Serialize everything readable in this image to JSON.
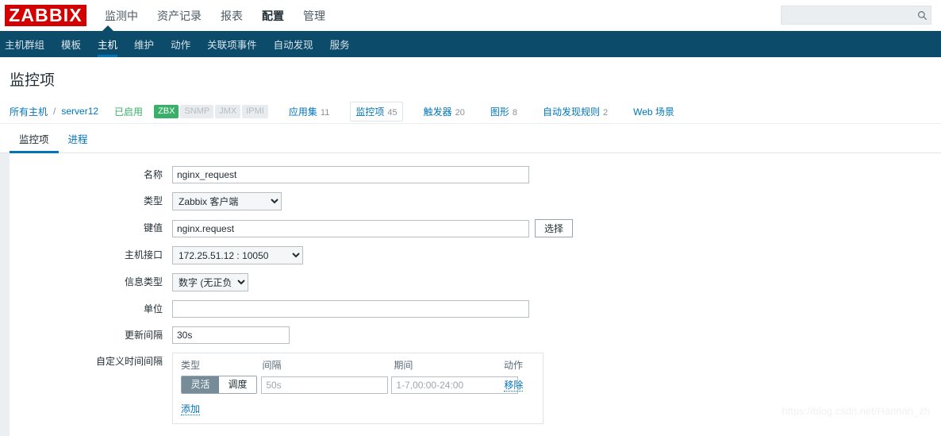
{
  "header": {
    "logo_text": "ZABBIX",
    "brand_color": "#d40000",
    "main_nav": [
      {
        "label": "监测中",
        "active": false
      },
      {
        "label": "资产记录",
        "active": false
      },
      {
        "label": "报表",
        "active": false
      },
      {
        "label": "配置",
        "active": true
      },
      {
        "label": "管理",
        "active": false
      }
    ],
    "search": {
      "value": "",
      "placeholder": "",
      "icon": "search-icon"
    }
  },
  "subnav": {
    "background": "#0c4b69",
    "items": [
      {
        "label": "主机群组",
        "active": false
      },
      {
        "label": "模板",
        "active": false
      },
      {
        "label": "主机",
        "active": true
      },
      {
        "label": "维护",
        "active": false
      },
      {
        "label": "动作",
        "active": false
      },
      {
        "label": "关联项事件",
        "active": false
      },
      {
        "label": "自动发现",
        "active": false
      },
      {
        "label": "服务",
        "active": false
      }
    ]
  },
  "page": {
    "title": "监控项"
  },
  "object_nav": {
    "breadcrumb_root": "所有主机",
    "separator": "/",
    "host": "server12",
    "status": "已启用",
    "status_color": "#3aaf6a",
    "protocols": [
      {
        "label": "ZBX",
        "enabled": true
      },
      {
        "label": "SNMP",
        "enabled": false
      },
      {
        "label": "JMX",
        "enabled": false
      },
      {
        "label": "IPMI",
        "enabled": false
      }
    ],
    "links": [
      {
        "label": "应用集",
        "count": "11",
        "selected": false
      },
      {
        "label": "监控项",
        "count": "45",
        "selected": true
      },
      {
        "label": "触发器",
        "count": "20",
        "selected": false
      },
      {
        "label": "图形",
        "count": "8",
        "selected": false
      },
      {
        "label": "自动发现规则",
        "count": "2",
        "selected": false
      },
      {
        "label": "Web 场景",
        "count": "",
        "selected": false
      }
    ]
  },
  "form_tabs": [
    {
      "label": "监控项",
      "active": true
    },
    {
      "label": "进程",
      "active": false
    }
  ],
  "form": {
    "name": {
      "label": "名称",
      "value": "nginx_request",
      "placeholder": ""
    },
    "type": {
      "label": "类型",
      "value": "Zabbix 客户端",
      "options": [
        "Zabbix 客户端"
      ]
    },
    "key": {
      "label": "键值",
      "value": "nginx.request",
      "placeholder": "",
      "button": "选择"
    },
    "host_interface": {
      "label": "主机接口",
      "value": "172.25.51.12 : 10050",
      "options": [
        "172.25.51.12 : 10050"
      ]
    },
    "info_type": {
      "label": "信息类型",
      "value": "数字 (无正负)",
      "options": [
        "数字 (无正负)"
      ]
    },
    "units": {
      "label": "单位",
      "value": "",
      "placeholder": ""
    },
    "update_interval": {
      "label": "更新间隔",
      "value": "30s",
      "placeholder": ""
    },
    "custom_intervals": {
      "label": "自定义时间间隔",
      "columns": [
        "类型",
        "间隔",
        "期间",
        "动作"
      ],
      "rows": [
        {
          "type_options": [
            {
              "label": "灵活",
              "active": true
            },
            {
              "label": "调度",
              "active": false
            }
          ],
          "interval_value": "",
          "interval_placeholder": "50s",
          "period_value": "",
          "period_placeholder": "1-7,00:00-24:00",
          "action": "移除"
        }
      ],
      "add_label": "添加"
    }
  },
  "watermark": "https://blog.csdn.net/Hannah_zh"
}
